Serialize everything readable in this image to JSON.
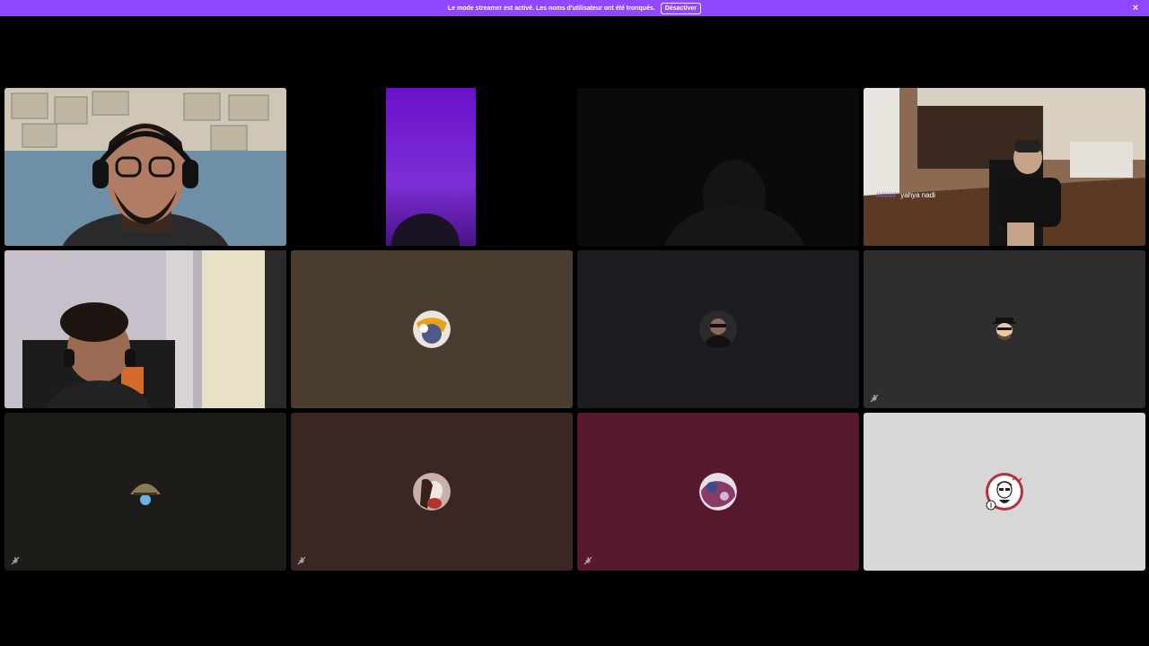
{
  "banner": {
    "message": "Le mode streamer est activé. Les noms d'utilisateur ont été tronqués.",
    "button_label": "Désactiver",
    "close_icon": "×",
    "color": "#9146ff"
  },
  "tiles": [
    {
      "id": "webcam-1",
      "type": "video",
      "bg": "#8d9aa8"
    },
    {
      "id": "webcam-2",
      "type": "video",
      "bg": "#000000"
    },
    {
      "id": "webcam-3",
      "type": "video",
      "bg": "#0a0a0a"
    },
    {
      "id": "webcam-4",
      "type": "video",
      "bg": "#6b5140",
      "name_tag": "#####",
      "name": "yahya nadi"
    },
    {
      "id": "webcam-5",
      "type": "video",
      "bg": "#c7c2c9",
      "speaking": true
    },
    {
      "id": "avatar-6",
      "type": "avatar",
      "bg": "#4b3c30",
      "muted": false
    },
    {
      "id": "avatar-7",
      "type": "avatar",
      "bg": "#1c1d21",
      "muted": false
    },
    {
      "id": "avatar-8",
      "type": "avatar",
      "bg": "#2e2e2e",
      "muted": true
    },
    {
      "id": "avatar-9",
      "type": "avatar",
      "bg": "#1e1c18",
      "muted": true
    },
    {
      "id": "avatar-10",
      "type": "avatar",
      "bg": "#3a2623",
      "muted": true
    },
    {
      "id": "avatar-11",
      "type": "avatar",
      "bg": "#56192f",
      "muted": true
    },
    {
      "id": "avatar-12",
      "type": "avatar",
      "bg": "#d7d7d7",
      "muted": false
    }
  ],
  "icons": {
    "muted": "mic-muted-icon",
    "close": "close-icon"
  },
  "colors": {
    "speaking_ring": "#43b581"
  }
}
